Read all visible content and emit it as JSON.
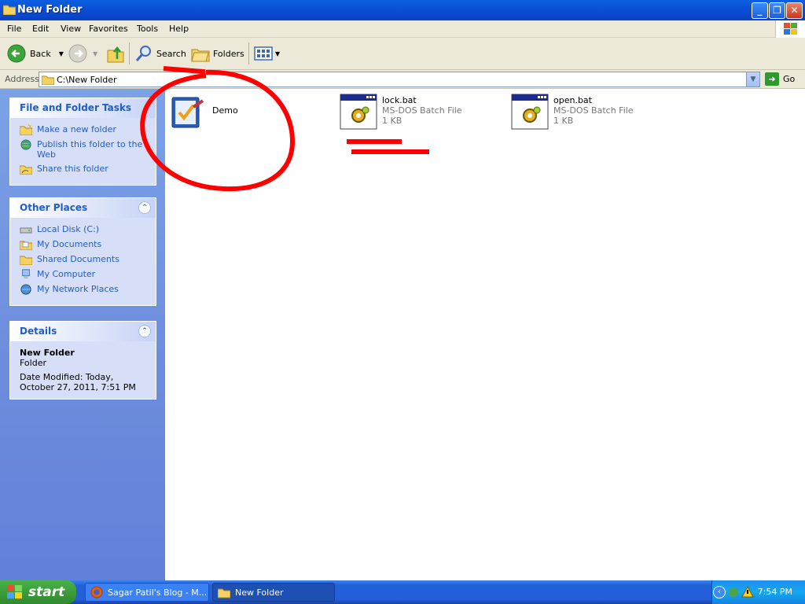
{
  "window": {
    "title": "New Folder"
  },
  "menu": [
    "File",
    "Edit",
    "View",
    "Favorites",
    "Tools",
    "Help"
  ],
  "toolbar": {
    "back_label": "Back",
    "search_label": "Search",
    "folders_label": "Folders"
  },
  "address": {
    "label": "Address",
    "path": "C:\\New Folder",
    "go_label": "Go"
  },
  "tasks_panel": {
    "title": "File and Folder Tasks",
    "items": [
      "Make a new folder",
      "Publish this folder to the Web",
      "Share this folder"
    ]
  },
  "other_places": {
    "title": "Other Places",
    "items": [
      "Local Disk (C:)",
      "My Documents",
      "Shared Documents",
      "My Computer",
      "My Network Places"
    ]
  },
  "details": {
    "title": "Details",
    "name": "New Folder",
    "type": "Folder",
    "modified": "Date Modified: Today, October 27, 2011, 7:51 PM"
  },
  "files": [
    {
      "name": "Demo"
    },
    {
      "name": "lock.bat",
      "type": "MS-DOS Batch File",
      "size": "1 KB"
    },
    {
      "name": "open.bat",
      "type": "MS-DOS Batch File",
      "size": "1 KB"
    }
  ],
  "taskbar": {
    "start_label": "start",
    "tasks": [
      "Sagar Patil's Blog - M...",
      "New Folder"
    ],
    "clock": "7:54 PM"
  },
  "colors": {
    "link": "#215dc6",
    "titlebar": "#0a4fd6",
    "annotation": "#ff0000"
  }
}
